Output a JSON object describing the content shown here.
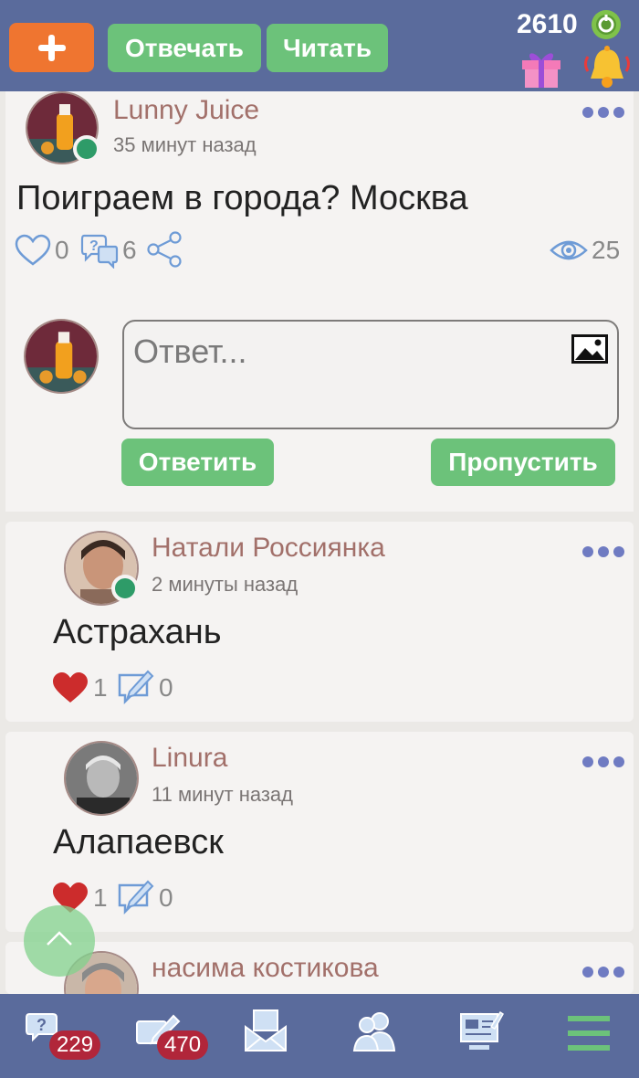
{
  "header": {
    "add_label": "+",
    "answer_tab": "Отвечать",
    "read_tab": "Читать",
    "coins": "2610"
  },
  "post": {
    "author": "Lunny Juice",
    "time": "35 минут назад",
    "text": "Поиграем в города? Москва",
    "likes": "0",
    "answers": "6",
    "views": "25"
  },
  "reply": {
    "placeholder": "Ответ...",
    "submit_label": "Ответить",
    "skip_label": "Пропустить"
  },
  "comments": [
    {
      "author": "Натали Россиянка",
      "time": "2 минуты назад",
      "text": "Астрахань",
      "likes": "1",
      "replies": "0"
    },
    {
      "author": "Linura",
      "time": "11 минут назад",
      "text": "Алапаевск",
      "likes": "1",
      "replies": "0"
    },
    {
      "author": "насима костикова"
    }
  ],
  "bottom_nav": {
    "questions_badge": "229",
    "answers_badge": "470"
  },
  "colors": {
    "bar": "#5a6b9c",
    "green_button": "#6cc27a",
    "orange_button": "#ef7530",
    "author": "#a2706a",
    "badge": "#b1263a"
  }
}
